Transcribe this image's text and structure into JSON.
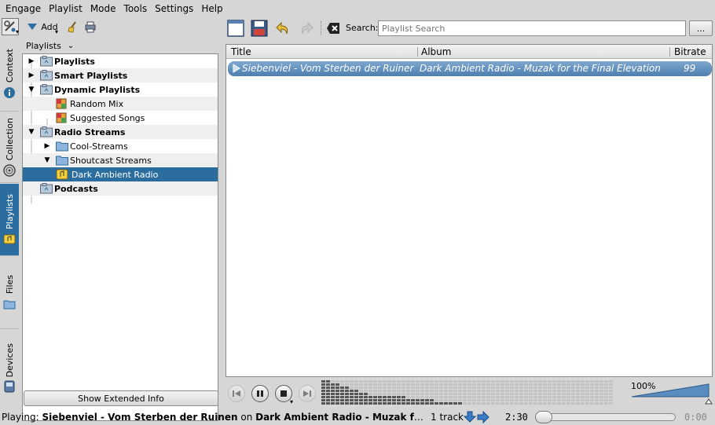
{
  "menubar": {
    "items": [
      "Engage",
      "Playlist",
      "Mode",
      "Tools",
      "Settings",
      "Help"
    ]
  },
  "left_toolbar": {
    "add_label": "Add"
  },
  "side_tabs": [
    {
      "label": "Context",
      "icon": "info-icon"
    },
    {
      "label": "Collection",
      "icon": "collection-icon"
    },
    {
      "label": "Playlists",
      "icon": "playlist-icon",
      "active": true
    },
    {
      "label": "Files",
      "icon": "folder-icon"
    },
    {
      "label": "Devices",
      "icon": "device-icon"
    }
  ],
  "left_panel": {
    "selector_value": "Playlists",
    "tree": [
      {
        "label": "Playlists",
        "bold": true
      },
      {
        "label": "Smart Playlists",
        "bold": true
      },
      {
        "label": "Dynamic Playlists",
        "bold": true
      },
      {
        "label": "Random Mix"
      },
      {
        "label": "Suggested Songs"
      },
      {
        "label": "Radio Streams",
        "bold": true
      },
      {
        "label": "Cool-Streams"
      },
      {
        "label": "Shoutcast Streams"
      },
      {
        "label": "Dark Ambient Radio",
        "selected": true
      },
      {
        "label": "Podcasts",
        "bold": true
      }
    ],
    "extended_info_button": "Show Extended Info"
  },
  "playlist_toolbar": {
    "search_label": "Search:",
    "search_placeholder": "Playlist Search",
    "more_label": "..."
  },
  "playlist": {
    "columns": [
      "Title",
      "Album",
      "Bitrate"
    ],
    "rows": [
      {
        "title": "Siebenviel - Vom Sterben der Ruiner",
        "album": "Dark Ambient Radio - Muzak for the Final Elevation",
        "bitrate": "99"
      }
    ]
  },
  "player": {
    "volume": "100%"
  },
  "statusbar": {
    "playing_prefix": "Playing: ",
    "track_artist_title": "Siebenviel - Vom Sterben der Ruinen",
    "on_word": " on ",
    "stream_name": "Dark Ambient Radio - Muzak for the Final Elev…",
    "track_count": "1 track",
    "elapsed": "2:30",
    "remaining": "0:00"
  },
  "colors": {
    "selection": "#2b6d9f",
    "window_bg": "#d6d6d6"
  }
}
